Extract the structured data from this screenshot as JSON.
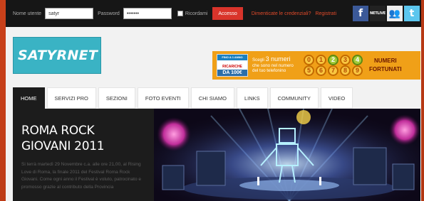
{
  "login": {
    "username_label": "Nome utente",
    "username_value": "satyr",
    "password_label": "Password",
    "password_value": "•••••••",
    "remember_label": "Ricordami",
    "login_button": "Accesso",
    "forgot_link": "Dimenticate le credenziali?",
    "register_link": "Registrati"
  },
  "social": {
    "facebook": "f",
    "netlive": "NETLIVE",
    "myspace": "👥",
    "twitter": "t"
  },
  "logo": {
    "text": "SATYRNET"
  },
  "banner": {
    "card_top": "FINO A 1 ANNO",
    "card_ricariche": "RICARICHE",
    "card_da": "DA 100€",
    "text_line1": "Scegli",
    "text_bold": "3 numeri",
    "text_line2": "che sono nel numero",
    "text_line3": "del tuo telefonino",
    "numbers": [
      "0",
      "1",
      "2",
      "3",
      "4",
      "5",
      "6",
      "7",
      "8",
      "9"
    ],
    "right_line1": "NUMERI",
    "right_line2": "FORTUNATI"
  },
  "nav": {
    "items": [
      "HOME",
      "SERVIZI PRO",
      "SEZIONI",
      "FOTO EVENTI",
      "CHI SIAMO",
      "LINKS",
      "COMMUNITY",
      "VIDEO"
    ]
  },
  "article": {
    "title": "ROMA ROCK GIOVANI 2011",
    "body": "Si terrà martedì 29 Novembre c.a. alle ore 21,00, al Rising Love di Roma, la finale 2011 del Festival Roma Rock Giovani. Come ogni anno il Festival è voluto, patrocinato e promosso grazie al contributo della Provincia"
  },
  "colors": {
    "accent_red": "#d9342b",
    "logo_teal": "#3ab3c4",
    "banner_orange": "#f0a018"
  }
}
